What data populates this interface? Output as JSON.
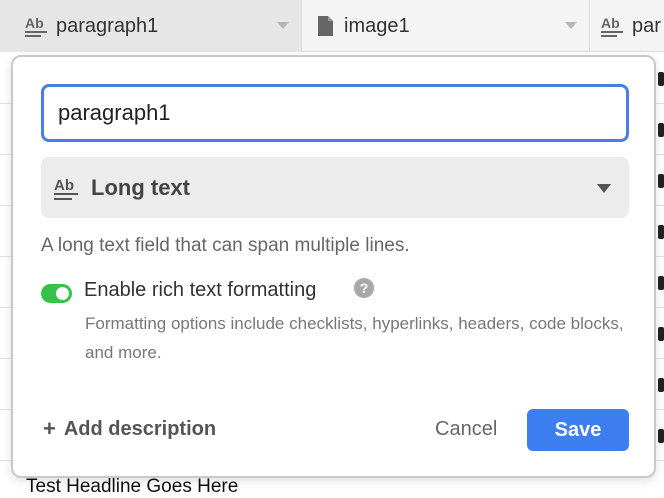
{
  "columns": [
    {
      "icon": "long-text-icon",
      "label": "paragraph1"
    },
    {
      "icon": "attachment-icon",
      "label": "image1"
    },
    {
      "icon": "long-text-icon",
      "label": "par"
    }
  ],
  "bottom_cell": "Test Headline Goes Here",
  "field_editor": {
    "name_value": "paragraph1",
    "type_label": "Long text",
    "type_icon": "long-text-icon",
    "type_description": "A long text field that can span multiple lines.",
    "rich_text": {
      "label": "Enable rich text formatting",
      "enabled": true,
      "help": "Formatting options include checklists, hyperlinks, headers, code blocks, and more."
    },
    "add_description_label": "Add description",
    "cancel_label": "Cancel",
    "save_label": "Save",
    "colors": {
      "accent": "#3d7ef0",
      "toggle_on": "#34c24a"
    }
  }
}
